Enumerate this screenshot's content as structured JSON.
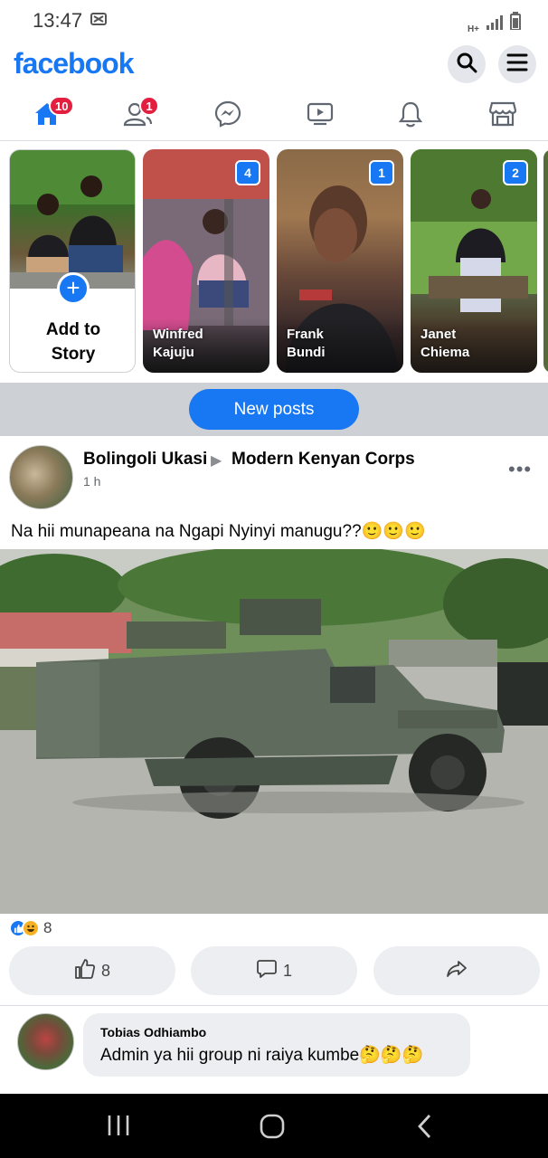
{
  "status_bar": {
    "time": "13:47",
    "network": "H+"
  },
  "header": {
    "logo": "facebook",
    "search_icon": "search-icon",
    "menu_icon": "menu-icon"
  },
  "nav": {
    "items": [
      {
        "name": "home",
        "icon": "home-icon",
        "badge": "10",
        "active": true
      },
      {
        "name": "friends",
        "icon": "friends-icon",
        "badge": "1"
      },
      {
        "name": "messenger",
        "icon": "messenger-icon",
        "badge": ""
      },
      {
        "name": "watch",
        "icon": "video-icon",
        "badge": ""
      },
      {
        "name": "notifications",
        "icon": "bell-icon",
        "badge": ""
      },
      {
        "name": "marketplace",
        "icon": "shop-icon",
        "badge": ""
      }
    ]
  },
  "stories": {
    "add_label_line1": "Add to",
    "add_label_line2": "Story",
    "items": [
      {
        "name_line1": "Winfred",
        "name_line2": "Kajuju",
        "count": "4"
      },
      {
        "name_line1": "Frank",
        "name_line2": "Bundi",
        "count": "1"
      },
      {
        "name_line1": "Janet",
        "name_line2": "Chiema",
        "count": "2"
      }
    ]
  },
  "new_posts_label": "New posts",
  "post": {
    "author": "Bolingoli Ukasi",
    "group": "Modern Kenyan Corps",
    "time": "1 h",
    "text": "Na hii munapeana na Ngapi Nyinyi manugu??🙂🙂🙂",
    "reaction_count": "8",
    "like_count": "8",
    "comment_count": "1"
  },
  "comment": {
    "author": "Tobias Odhiambo",
    "text": "Admin ya  hii group ni raiya kumbe🤔🤔🤔"
  },
  "colors": {
    "brand": "#1877f2",
    "badge": "#e41e3f",
    "band": "#cdd1d5",
    "button_bg": "#eceef1"
  }
}
